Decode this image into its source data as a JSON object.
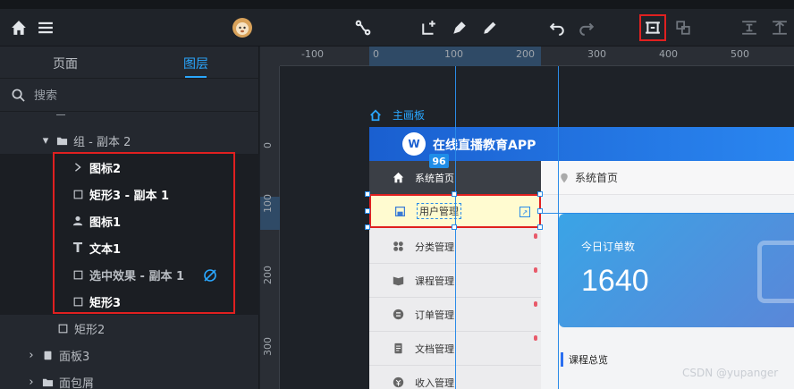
{
  "toolbar": {
    "icons": [
      "home-icon",
      "menu-icon",
      "avatar",
      "connect-icon",
      "add-page-icon",
      "pen-icon",
      "pencil-icon",
      "undo-icon",
      "redo-icon",
      "frame-icon",
      "ungroup-icon",
      "align-top-icon",
      "align-middle-icon"
    ]
  },
  "left_panel": {
    "tabs": [
      {
        "label": "页面",
        "active": false
      },
      {
        "label": "图层",
        "active": true
      }
    ],
    "search": {
      "placeholder": "搜索"
    },
    "layers": [
      {
        "label": "组 - 副本 2",
        "icon": "folder-icon",
        "expanded": true
      },
      {
        "label": "图标2",
        "icon": "chevron-right-icon",
        "bold": true
      },
      {
        "label": "矩形3 - 副本 1",
        "icon": "square-icon",
        "bold": true
      },
      {
        "label": "图标1",
        "icon": "user-icon",
        "bold": true
      },
      {
        "label": "文本1",
        "icon": "text-icon",
        "bold": true
      },
      {
        "label": "选中效果 - 副本 1",
        "icon": "square-icon",
        "bold": false,
        "hidden": true
      },
      {
        "label": "矩形3",
        "icon": "square-icon",
        "bold": true
      },
      {
        "label": "矩形2",
        "icon": "square-icon",
        "bold": false
      },
      {
        "label": "面板3",
        "icon": "panel-icon",
        "bold": false
      },
      {
        "label": "面包屑",
        "icon": "folder-icon",
        "bold": false
      }
    ]
  },
  "rulers": {
    "h_labels": [
      "-100",
      "0",
      "100",
      "200",
      "300",
      "400",
      "500"
    ],
    "v_labels": [
      "0",
      "100",
      "200",
      "300"
    ]
  },
  "artboard": {
    "label": "主画板"
  },
  "app": {
    "title": "在线直播教育APP",
    "logo_text": "W",
    "badge": "96",
    "menu": [
      {
        "label": "系统首页",
        "icon": "home-icon"
      },
      {
        "label": "用户管理",
        "icon": "save-icon",
        "selected": true
      },
      {
        "label": "分类管理",
        "icon": "grid-icon"
      },
      {
        "label": "课程管理",
        "icon": "book-icon"
      },
      {
        "label": "订单管理",
        "icon": "list-icon"
      },
      {
        "label": "文档管理",
        "icon": "doc-icon"
      },
      {
        "label": "收入管理",
        "icon": "money-icon"
      }
    ],
    "breadcrumb": "系统首页",
    "stat": {
      "label": "今日订单数",
      "value": "1640"
    },
    "section_title": "课程总览"
  },
  "watermark": "CSDN @yupanger",
  "colors": {
    "accent": "#2aa7ff",
    "highlight": "#e02020",
    "header": "#1a5fd0"
  }
}
